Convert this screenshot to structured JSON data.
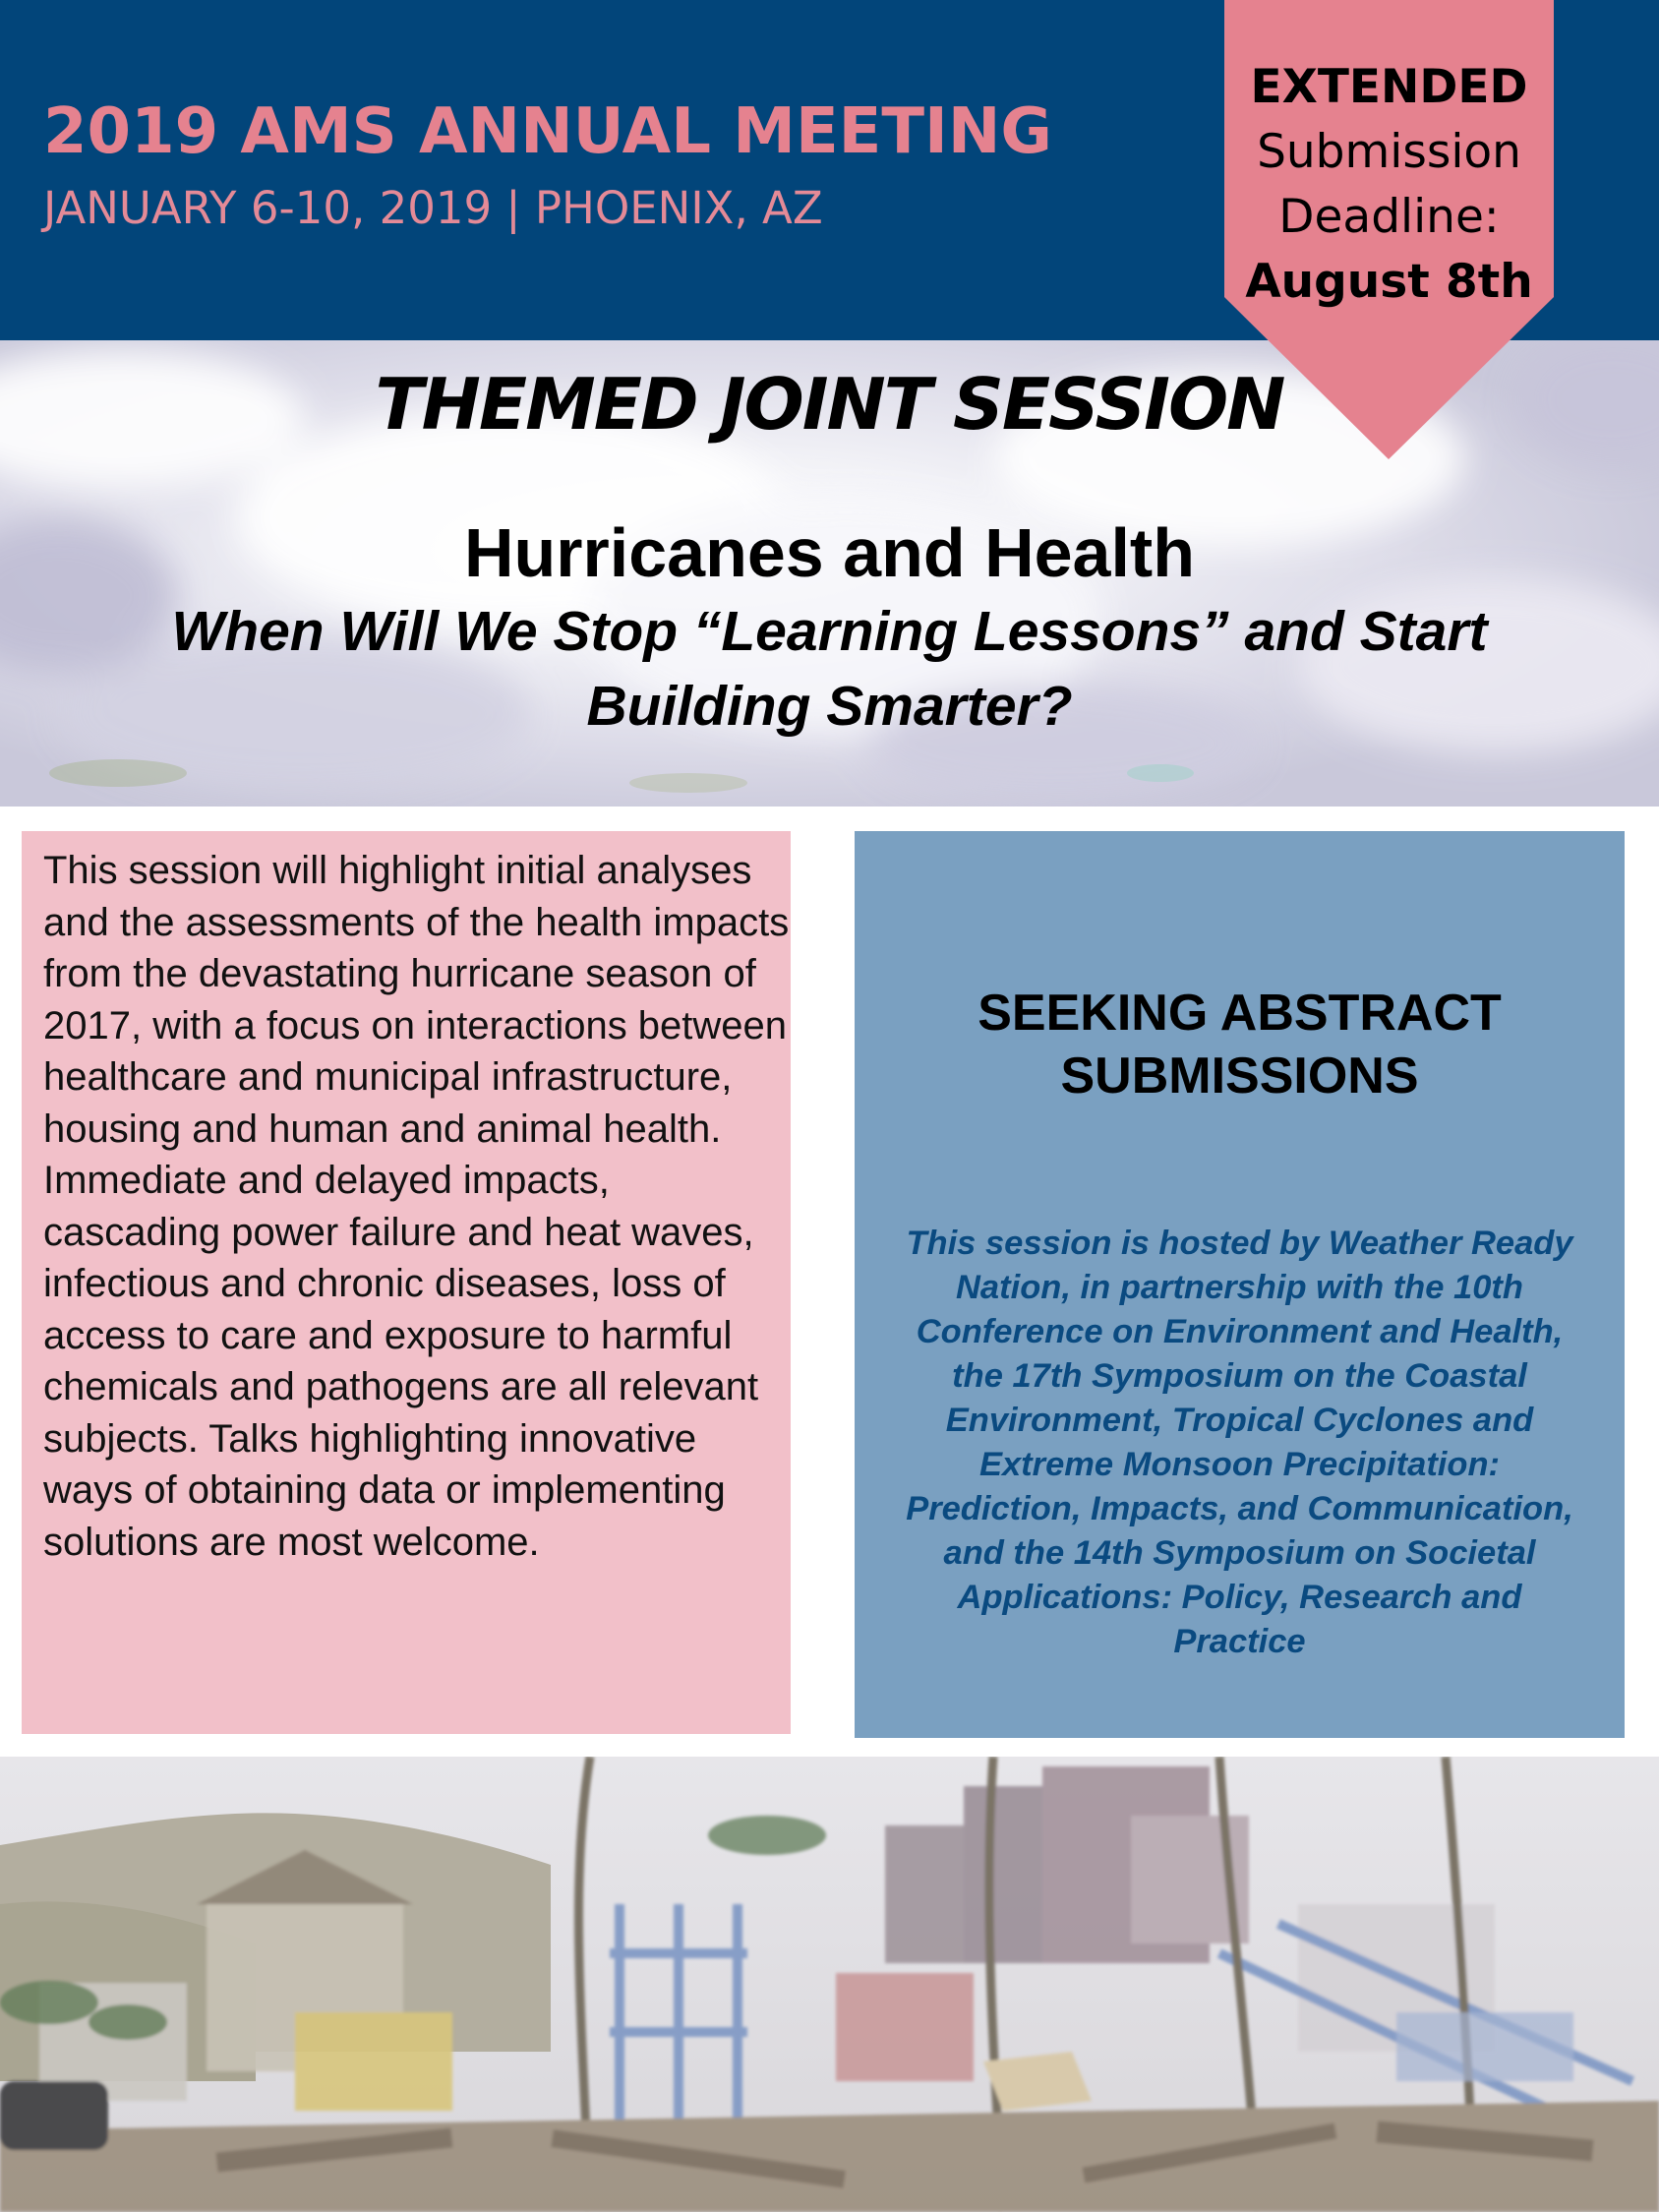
{
  "header": {
    "title": "2019 AMS ANNUAL MEETING",
    "dates": "JANUARY 6-10, 2019 | PHOENIX, AZ"
  },
  "deadline": {
    "line1": "EXTENDED",
    "line2": "Submission",
    "line3": "Deadline:",
    "line4": "August 8th"
  },
  "session": {
    "label": "THEMED JOINT SESSION",
    "title": "Hurricanes and Health",
    "subtitle": "When Will We Stop “Learning Lessons” and Start Building Smarter?"
  },
  "description": {
    "text": "This session will highlight initial analyses and the assessments of the health impacts from the devastating hurricane season of 2017, with a focus on interactions between healthcare and municipal infrastructure, housing and human and animal health.  Immediate and delayed impacts, cascading power failure and heat waves, infectious and chronic diseases, loss of access to care and exposure to harmful chemicals and pathogens are all relevant subjects.  Talks highlighting innovative ways of obtaining data or implementing solutions are most welcome."
  },
  "abstracts": {
    "heading": "SEEKING ABSTRACT SUBMISSIONS",
    "hosted_by": "This session is hosted by Weather Ready Nation, in partnership with the 10th Conference on Environment and Health, the 17th Symposium on the Coastal Environment, Tropical Cyclones and Extreme Monsoon Precipitation: Prediction, Impacts, and Communication, and the 14th Symposium on Societal Applications: Policy, Research and Practice"
  },
  "colors": {
    "header_blue": "#02457a",
    "accent_pink": "#e5828f",
    "description_panel_pink": "#f2c0c9",
    "abstract_panel_blue": "#7aa0c1",
    "host_text_blue": "#0a4a80"
  }
}
